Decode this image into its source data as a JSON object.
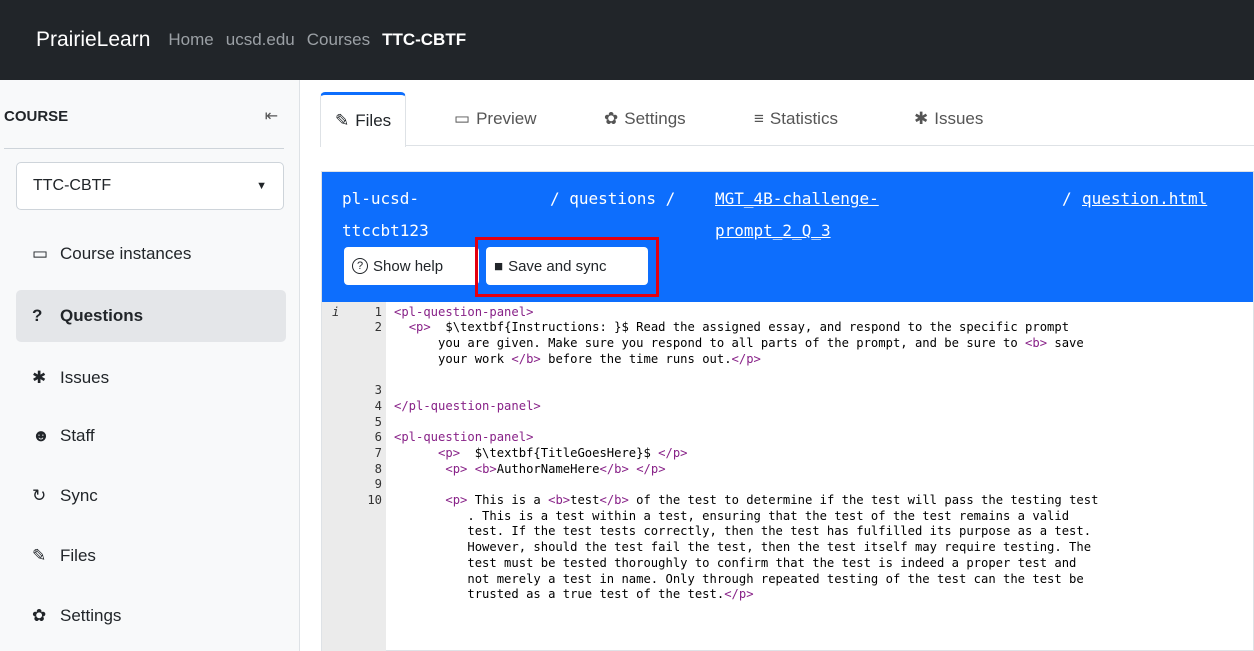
{
  "navbar": {
    "brand": "PrairieLearn",
    "links": [
      "Home",
      "ucsd.edu",
      "Courses",
      "TTC-CBTF"
    ]
  },
  "sidebar": {
    "title": "COURSE",
    "collapse_glyph": "⇤",
    "course_select": "TTC-CBTF",
    "items": [
      {
        "label": "Course instances",
        "icon": "chalkboard-icon",
        "glyph": "▭"
      },
      {
        "label": "Questions",
        "icon": "question-icon",
        "glyph": "?"
      },
      {
        "label": "Issues",
        "icon": "bug-icon",
        "glyph": "✱"
      },
      {
        "label": "Staff",
        "icon": "users-icon",
        "glyph": "☻"
      },
      {
        "label": "Sync",
        "icon": "sync-icon",
        "glyph": "↻"
      },
      {
        "label": "Files",
        "icon": "edit-icon",
        "glyph": "✎"
      },
      {
        "label": "Settings",
        "icon": "gear-icon",
        "glyph": "✿"
      }
    ]
  },
  "tabs": [
    {
      "label": "Files",
      "icon": "edit-icon",
      "glyph": "✎"
    },
    {
      "label": "Preview",
      "icon": "monitor-icon",
      "glyph": "▭"
    },
    {
      "label": "Settings",
      "icon": "gear-icon",
      "glyph": "✿"
    },
    {
      "label": "Statistics",
      "icon": "chart-icon",
      "glyph": "≡"
    },
    {
      "label": "Issues",
      "icon": "bug-icon",
      "glyph": "✱"
    }
  ],
  "breadcrumb": {
    "root_1": "pl-ucsd-",
    "root_2": "ttccbt123",
    "sep1": "/ questions /",
    "folder_1": "MGT_4B-challenge-",
    "folder_2": "prompt_2_Q_3",
    "sep2": "/",
    "file": "question.html"
  },
  "buttons": {
    "show_help": "Show help",
    "show_help_glyph": "?",
    "save_sync": "Save and sync",
    "save_sync_glyph": "■"
  },
  "highlight_color": "#e30010",
  "editor": {
    "info_marker": "i",
    "line_numbers": [
      "1",
      "2",
      "3",
      "4",
      "5",
      "6",
      "7",
      "8",
      "9",
      "10"
    ],
    "fold_marks": [
      "1",
      "6"
    ],
    "lines": [
      "<pl-question-panel>",
      "  <p>  $\\textbf{Instructions: }$ Read the assigned essay, and respond to the specific prompt",
      "      you are given. Make sure you respond to all parts of the prompt, and be sure to <b> save",
      "      your work </b> before the time runs out.</p>",
      "",
      "</pl-question-panel>",
      "",
      "<pl-question-panel>",
      "      <p>  $\\textbf{TitleGoesHere}$ </p>",
      "       <p> <b>AuthorNameHere</b> </p>",
      "",
      "       <p> This is a <b>test</b> of the test to determine if the test will pass the testing test",
      "          . This is a test within a test, ensuring that the test of the test remains a valid",
      "          test. If the test tests correctly, then the test has fulfilled its purpose as a test.",
      "          However, should the test fail the test, then the test itself may require testing. The",
      "          test must be tested thoroughly to confirm that the test is indeed a proper test and",
      "          not merely a test in name. Only through repeated testing of the test can the test be",
      "          trusted as a true test of the test.</p>"
    ]
  }
}
